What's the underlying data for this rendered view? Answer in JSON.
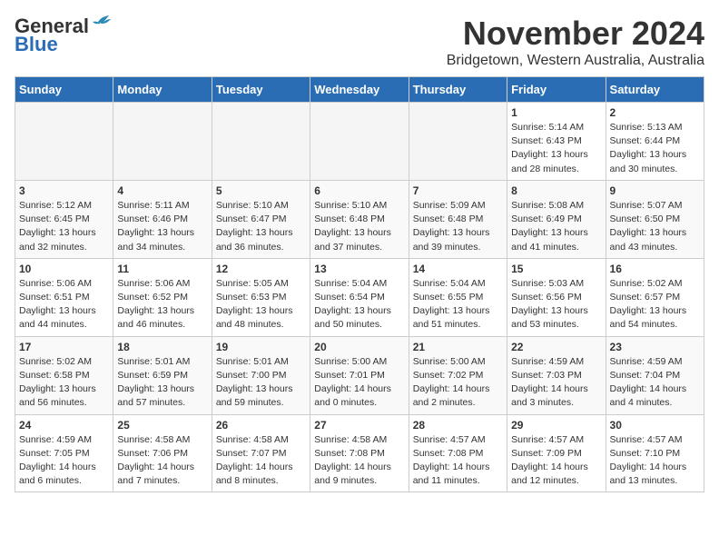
{
  "header": {
    "logo_general": "General",
    "logo_blue": "Blue",
    "month_year": "November 2024",
    "location": "Bridgetown, Western Australia, Australia"
  },
  "weekdays": [
    "Sunday",
    "Monday",
    "Tuesday",
    "Wednesday",
    "Thursday",
    "Friday",
    "Saturday"
  ],
  "weeks": [
    [
      {
        "day": "",
        "info": ""
      },
      {
        "day": "",
        "info": ""
      },
      {
        "day": "",
        "info": ""
      },
      {
        "day": "",
        "info": ""
      },
      {
        "day": "",
        "info": ""
      },
      {
        "day": "1",
        "info": "Sunrise: 5:14 AM\nSunset: 6:43 PM\nDaylight: 13 hours\nand 28 minutes."
      },
      {
        "day": "2",
        "info": "Sunrise: 5:13 AM\nSunset: 6:44 PM\nDaylight: 13 hours\nand 30 minutes."
      }
    ],
    [
      {
        "day": "3",
        "info": "Sunrise: 5:12 AM\nSunset: 6:45 PM\nDaylight: 13 hours\nand 32 minutes."
      },
      {
        "day": "4",
        "info": "Sunrise: 5:11 AM\nSunset: 6:46 PM\nDaylight: 13 hours\nand 34 minutes."
      },
      {
        "day": "5",
        "info": "Sunrise: 5:10 AM\nSunset: 6:47 PM\nDaylight: 13 hours\nand 36 minutes."
      },
      {
        "day": "6",
        "info": "Sunrise: 5:10 AM\nSunset: 6:48 PM\nDaylight: 13 hours\nand 37 minutes."
      },
      {
        "day": "7",
        "info": "Sunrise: 5:09 AM\nSunset: 6:48 PM\nDaylight: 13 hours\nand 39 minutes."
      },
      {
        "day": "8",
        "info": "Sunrise: 5:08 AM\nSunset: 6:49 PM\nDaylight: 13 hours\nand 41 minutes."
      },
      {
        "day": "9",
        "info": "Sunrise: 5:07 AM\nSunset: 6:50 PM\nDaylight: 13 hours\nand 43 minutes."
      }
    ],
    [
      {
        "day": "10",
        "info": "Sunrise: 5:06 AM\nSunset: 6:51 PM\nDaylight: 13 hours\nand 44 minutes."
      },
      {
        "day": "11",
        "info": "Sunrise: 5:06 AM\nSunset: 6:52 PM\nDaylight: 13 hours\nand 46 minutes."
      },
      {
        "day": "12",
        "info": "Sunrise: 5:05 AM\nSunset: 6:53 PM\nDaylight: 13 hours\nand 48 minutes."
      },
      {
        "day": "13",
        "info": "Sunrise: 5:04 AM\nSunset: 6:54 PM\nDaylight: 13 hours\nand 50 minutes."
      },
      {
        "day": "14",
        "info": "Sunrise: 5:04 AM\nSunset: 6:55 PM\nDaylight: 13 hours\nand 51 minutes."
      },
      {
        "day": "15",
        "info": "Sunrise: 5:03 AM\nSunset: 6:56 PM\nDaylight: 13 hours\nand 53 minutes."
      },
      {
        "day": "16",
        "info": "Sunrise: 5:02 AM\nSunset: 6:57 PM\nDaylight: 13 hours\nand 54 minutes."
      }
    ],
    [
      {
        "day": "17",
        "info": "Sunrise: 5:02 AM\nSunset: 6:58 PM\nDaylight: 13 hours\nand 56 minutes."
      },
      {
        "day": "18",
        "info": "Sunrise: 5:01 AM\nSunset: 6:59 PM\nDaylight: 13 hours\nand 57 minutes."
      },
      {
        "day": "19",
        "info": "Sunrise: 5:01 AM\nSunset: 7:00 PM\nDaylight: 13 hours\nand 59 minutes."
      },
      {
        "day": "20",
        "info": "Sunrise: 5:00 AM\nSunset: 7:01 PM\nDaylight: 14 hours\nand 0 minutes."
      },
      {
        "day": "21",
        "info": "Sunrise: 5:00 AM\nSunset: 7:02 PM\nDaylight: 14 hours\nand 2 minutes."
      },
      {
        "day": "22",
        "info": "Sunrise: 4:59 AM\nSunset: 7:03 PM\nDaylight: 14 hours\nand 3 minutes."
      },
      {
        "day": "23",
        "info": "Sunrise: 4:59 AM\nSunset: 7:04 PM\nDaylight: 14 hours\nand 4 minutes."
      }
    ],
    [
      {
        "day": "24",
        "info": "Sunrise: 4:59 AM\nSunset: 7:05 PM\nDaylight: 14 hours\nand 6 minutes."
      },
      {
        "day": "25",
        "info": "Sunrise: 4:58 AM\nSunset: 7:06 PM\nDaylight: 14 hours\nand 7 minutes."
      },
      {
        "day": "26",
        "info": "Sunrise: 4:58 AM\nSunset: 7:07 PM\nDaylight: 14 hours\nand 8 minutes."
      },
      {
        "day": "27",
        "info": "Sunrise: 4:58 AM\nSunset: 7:08 PM\nDaylight: 14 hours\nand 9 minutes."
      },
      {
        "day": "28",
        "info": "Sunrise: 4:57 AM\nSunset: 7:08 PM\nDaylight: 14 hours\nand 11 minutes."
      },
      {
        "day": "29",
        "info": "Sunrise: 4:57 AM\nSunset: 7:09 PM\nDaylight: 14 hours\nand 12 minutes."
      },
      {
        "day": "30",
        "info": "Sunrise: 4:57 AM\nSunset: 7:10 PM\nDaylight: 14 hours\nand 13 minutes."
      }
    ]
  ]
}
